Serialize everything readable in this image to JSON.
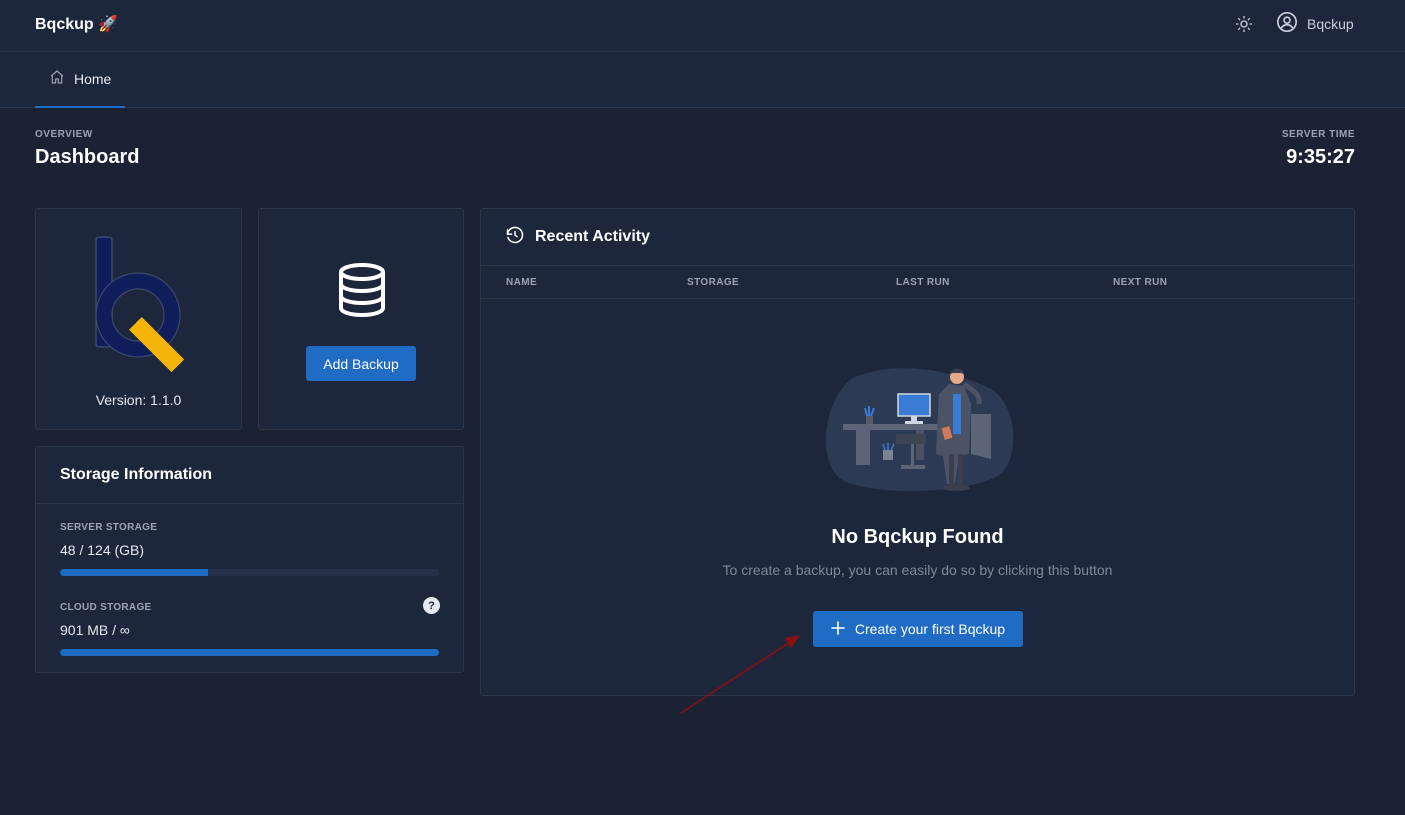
{
  "header": {
    "brand": "Bqckup 🚀",
    "user_name": "Bqckup",
    "icons": {
      "theme": "sun-icon",
      "user": "user-circle-icon"
    }
  },
  "nav": {
    "items": [
      {
        "label": "Home",
        "icon": "home-icon",
        "active": true
      }
    ]
  },
  "page": {
    "pretitle": "OVERVIEW",
    "title": "Dashboard",
    "server_time_label": "SERVER TIME",
    "server_time": "9:35:27"
  },
  "logo_card": {
    "version": "Version: 1.1.0"
  },
  "add_card": {
    "icon": "database-icon",
    "button_label": "Add Backup"
  },
  "storage": {
    "title": "Storage Information",
    "server": {
      "label": "SERVER STORAGE",
      "value": "48 / 124 (GB)",
      "progress": 0.39
    },
    "cloud": {
      "label": "CLOUD STORAGE",
      "value": "901 MB / ∞",
      "progress": 1.0,
      "help": "?"
    }
  },
  "activity": {
    "title": "Recent Activity",
    "icon": "history-icon",
    "columns": [
      "NAME",
      "STORAGE",
      "LAST RUN",
      "NEXT RUN"
    ],
    "rows": [],
    "empty_title": "No Bqckup Found",
    "empty_subtitle": "To create a backup, you can easily do so by clicking this button",
    "create_button": "Create your first Bqckup"
  },
  "colors": {
    "background": "#1a2234",
    "surface": "#1d273b",
    "border": "#2b3648",
    "primary": "#206bc4",
    "logo_navy": "#0f1e5a",
    "logo_yellow": "#f5b40a",
    "annotation_arrow": "#8b0f0f"
  }
}
